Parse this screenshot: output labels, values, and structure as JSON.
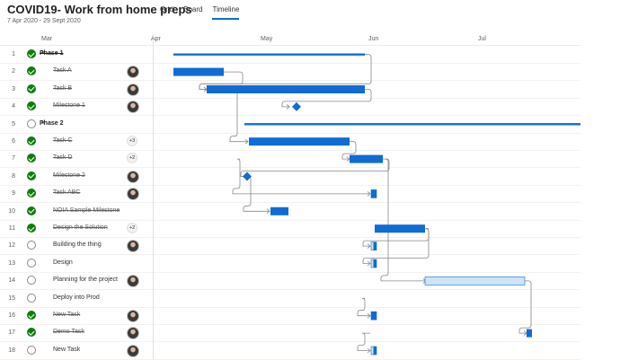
{
  "app": {
    "title": "COVID19- Work from home preps",
    "dates": "7 Apr 2020 - 29 Sept 2020"
  },
  "tabs": [
    {
      "label": "Grid",
      "active": false
    },
    {
      "label": "Board",
      "active": false
    },
    {
      "label": "Timeline",
      "active": true
    }
  ],
  "timeline": {
    "months": [
      "Mar",
      "Apr",
      "May",
      "Jun",
      "Jul"
    ]
  },
  "rows": [
    {
      "num": "1",
      "name": "Phase 1",
      "phase": true,
      "done": true,
      "assignee": "none",
      "extra": ""
    },
    {
      "num": "2",
      "name": "Task A",
      "phase": false,
      "done": true,
      "assignee": "avatar",
      "extra": ""
    },
    {
      "num": "3",
      "name": "Task B",
      "phase": false,
      "done": true,
      "assignee": "avatar",
      "extra": ""
    },
    {
      "num": "4",
      "name": "Milestone 1",
      "phase": false,
      "done": true,
      "assignee": "avatar",
      "extra": ""
    },
    {
      "num": "5",
      "name": "Phase 2",
      "phase": true,
      "done": false,
      "assignee": "none",
      "extra": ""
    },
    {
      "num": "6",
      "name": "Task C",
      "phase": false,
      "done": true,
      "assignee": "badge",
      "extra": "+3"
    },
    {
      "num": "7",
      "name": "Task D",
      "phase": false,
      "done": true,
      "assignee": "badge",
      "extra": "+2"
    },
    {
      "num": "8",
      "name": "Milestone 2",
      "phase": false,
      "done": true,
      "assignee": "avatar",
      "extra": ""
    },
    {
      "num": "9",
      "name": "Task ABC",
      "phase": false,
      "done": true,
      "assignee": "avatar",
      "extra": ""
    },
    {
      "num": "10",
      "name": "NOIA Sample Milestone",
      "phase": false,
      "done": true,
      "assignee": "none",
      "extra": ""
    },
    {
      "num": "11",
      "name": "Design the Solution",
      "phase": false,
      "done": true,
      "assignee": "badge",
      "extra": "+2"
    },
    {
      "num": "12",
      "name": "Building the thing",
      "phase": false,
      "done": false,
      "assignee": "avatar",
      "extra": ""
    },
    {
      "num": "13",
      "name": "Design",
      "phase": false,
      "done": false,
      "assignee": "none",
      "extra": ""
    },
    {
      "num": "14",
      "name": "Planning for the project",
      "phase": false,
      "done": false,
      "assignee": "avatar",
      "extra": ""
    },
    {
      "num": "15",
      "name": "Deploy into Prod",
      "phase": false,
      "done": false,
      "assignee": "none",
      "extra": ""
    },
    {
      "num": "16",
      "name": "New Task",
      "phase": false,
      "done": true,
      "assignee": "avatar",
      "extra": ""
    },
    {
      "num": "17",
      "name": "Demo Task",
      "phase": false,
      "done": true,
      "assignee": "avatar",
      "extra": ""
    },
    {
      "num": "18",
      "name": "New Task",
      "phase": false,
      "done": false,
      "assignee": "avatar",
      "extra": ""
    }
  ],
  "colors": {
    "bar": "#0f6cd5",
    "bar_light": "#cfe4f7",
    "connector": "#8a8886",
    "done": "#107c10",
    "accent": "#106ebe"
  }
}
